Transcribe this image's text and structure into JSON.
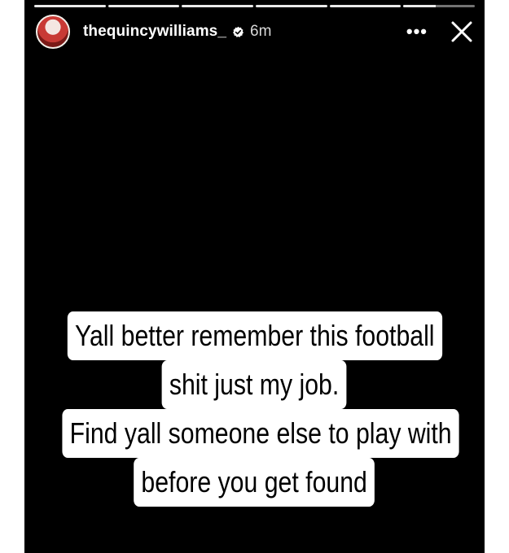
{
  "story": {
    "progress": [
      1,
      1,
      1,
      1,
      1,
      0.45
    ]
  },
  "header": {
    "username": "thequincywilliams_",
    "time": "6m",
    "more_label": "•••",
    "icons": {
      "avatar": "profile-avatar",
      "verified": "verified-badge-icon",
      "close": "close-icon"
    }
  },
  "caption": {
    "lines": [
      "Yall better remember this football",
      "shit just my job.",
      "Find yall someone else to play with",
      "before you get found"
    ]
  }
}
